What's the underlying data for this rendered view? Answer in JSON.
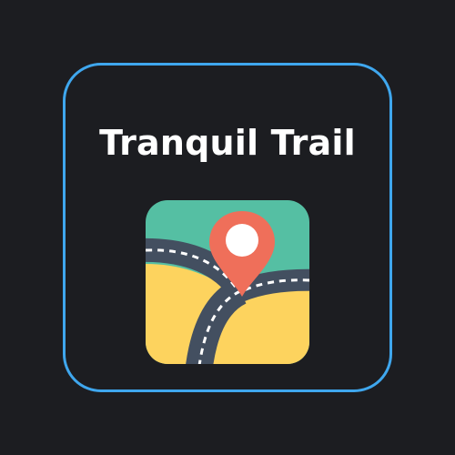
{
  "app": {
    "title": "Tranquil Trail",
    "icon": "map-location-pin-road-icon"
  },
  "colors": {
    "background": "#1c1d21",
    "frame_border": "#3fa7ee",
    "title_text": "#ffffff",
    "icon_sky": "#55bfa3",
    "icon_ground": "#fdd35e",
    "icon_road": "#434f60",
    "icon_road_dash": "#ffffff",
    "icon_pin": "#ef6f5a",
    "icon_pin_center": "#ffffff"
  }
}
